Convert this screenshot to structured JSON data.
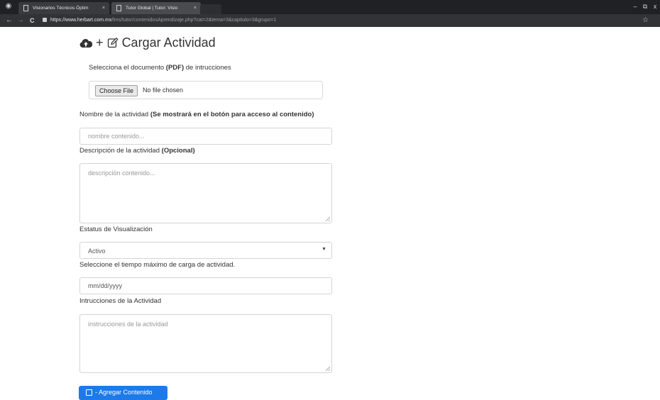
{
  "browser": {
    "tabs": [
      {
        "title": "Visionarios Técnicos Óptim"
      },
      {
        "title": "Tutor Global | Tutor: Visio"
      }
    ],
    "tab_close": "×",
    "url_host": "https://www.herbart.com.mx",
    "url_path": "/lms/tutor/contenidosAprendizaje.php?cat=2&tema=3&capitulo=3&grupo=1",
    "back_icon": "←",
    "forward_icon": "→",
    "reload_icon": "C",
    "star_icon": "☆",
    "win_minimize": "–",
    "win_restore": "⧉",
    "win_close": "x"
  },
  "header": {
    "upload_icon": "cloud-upload-icon",
    "plus": "+",
    "edit_icon": "edit-icon",
    "title": "Cargar Actividad"
  },
  "form": {
    "document": {
      "label_pre": "Selecciona el documento ",
      "label_bold": "(PDF)",
      "label_post": " de intrucciones",
      "choose_button": "Choose File",
      "no_file": "No file chosen"
    },
    "name": {
      "label_pre": "Nombre de la actividad ",
      "label_bold": "(Se mostrará en el botón para acceso al contenido)",
      "placeholder": "nombre contenido..."
    },
    "description": {
      "label_pre": "Descripción de la actividad ",
      "label_bold": "(Opcional)",
      "placeholder": "descripción contenido..."
    },
    "status": {
      "label": "Estatus de Visualización",
      "selected": "Activo",
      "caret": "▼"
    },
    "deadline": {
      "label": "Seleccione el tiempo máximo de carga de actividad.",
      "value": "mm/dd/yyyy"
    },
    "instructions": {
      "label": "Intrucciones de la Actividad",
      "placeholder": "instrucciones de la actividad"
    },
    "submit_label": "- Agregar Contenido"
  }
}
